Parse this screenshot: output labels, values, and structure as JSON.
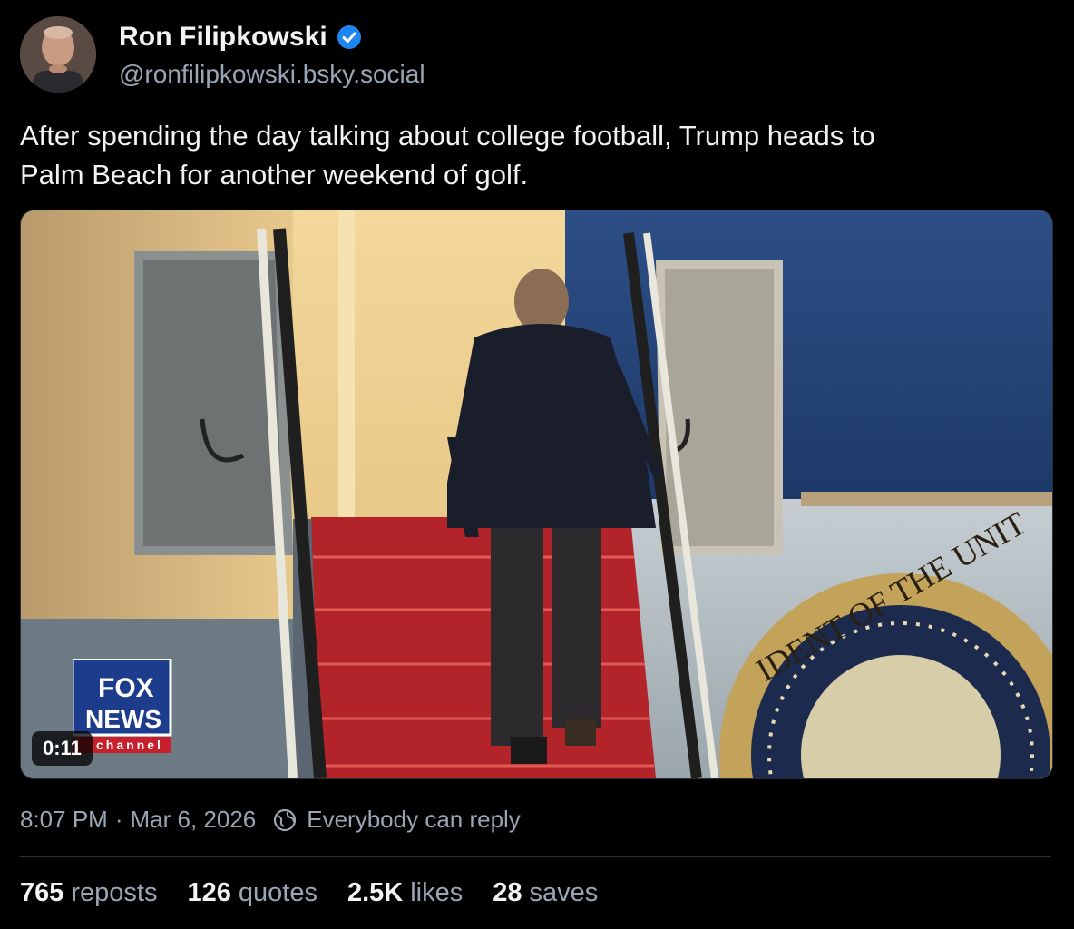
{
  "author": {
    "name": "Ron Filipkowski",
    "handle": "@ronfilipkowski.bsky.social",
    "verified": true,
    "avatar_icon": "avatar"
  },
  "post": {
    "text_line1": "After spending the day talking about college football, Trump heads to",
    "text_line2": "Palm Beach for another weekend of golf."
  },
  "video": {
    "duration": "0:11",
    "logo_line1": "FOX",
    "logo_line2": "NEWS",
    "logo_line3": "channel",
    "seal_text": "IDENT OF THE UNIT"
  },
  "meta": {
    "time": "8:07 PM",
    "separator": "·",
    "date": "Mar 6, 2026",
    "reply_setting": "Everybody can reply"
  },
  "stats": [
    {
      "value": "765",
      "label": "reposts"
    },
    {
      "value": "126",
      "label": "quotes"
    },
    {
      "value": "2.5K",
      "label": "likes"
    },
    {
      "value": "28",
      "label": "saves"
    }
  ],
  "colors": {
    "background": "#000000",
    "verified": "#1d86f0",
    "secondary_text": "#9aa6b4",
    "carpet": "#c4272a"
  }
}
